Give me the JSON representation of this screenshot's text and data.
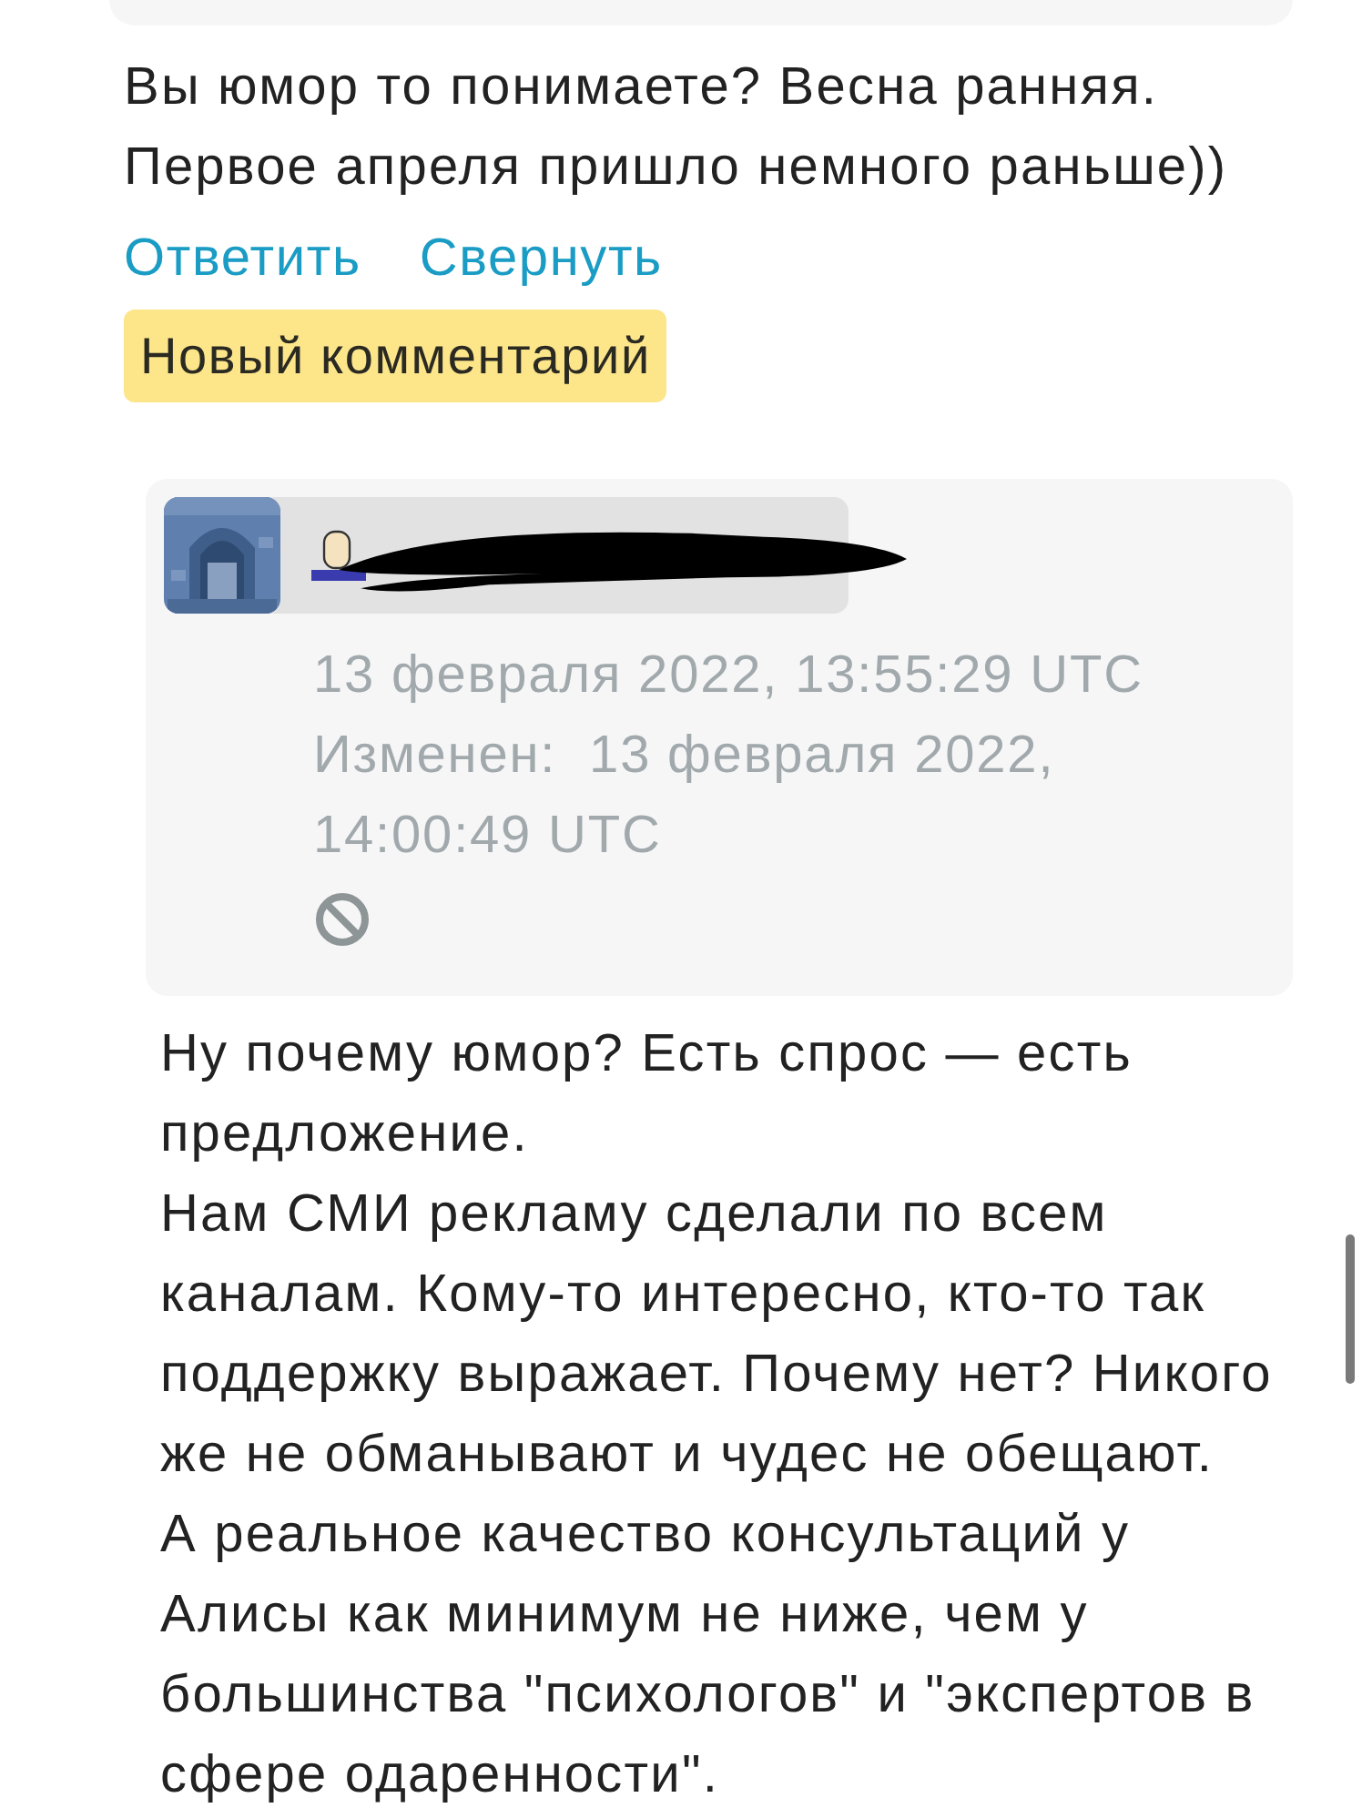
{
  "comment": {
    "text": "Вы юмор то понимаете? Весна ранняя. Первое апреля пришло немного раньше))",
    "actions": [
      {
        "label": "Ответить"
      },
      {
        "label": "Свернуть"
      }
    ],
    "badge": "Новый комментарий"
  },
  "reply": {
    "posted": "13 февраля 2022, 13:55:29 UTC",
    "edited_label": "Изменен:",
    "edited": "13 февраля 2022, 14:00:49 UTC",
    "body": [
      "Ну почему юмор? Есть спрос — есть предложение.",
      "Нам СМИ рекламу сделали по всем каналам. Кому-то интересно, кто-то так поддержку выражает. Почему нет? Никого же не обманывают и чудес не обещают.",
      "А реальное качество консультаций у Алисы как минимум не ниже, чем у большинства \"психологов\" и \"экспертов в сфере одаренности\"."
    ]
  }
}
